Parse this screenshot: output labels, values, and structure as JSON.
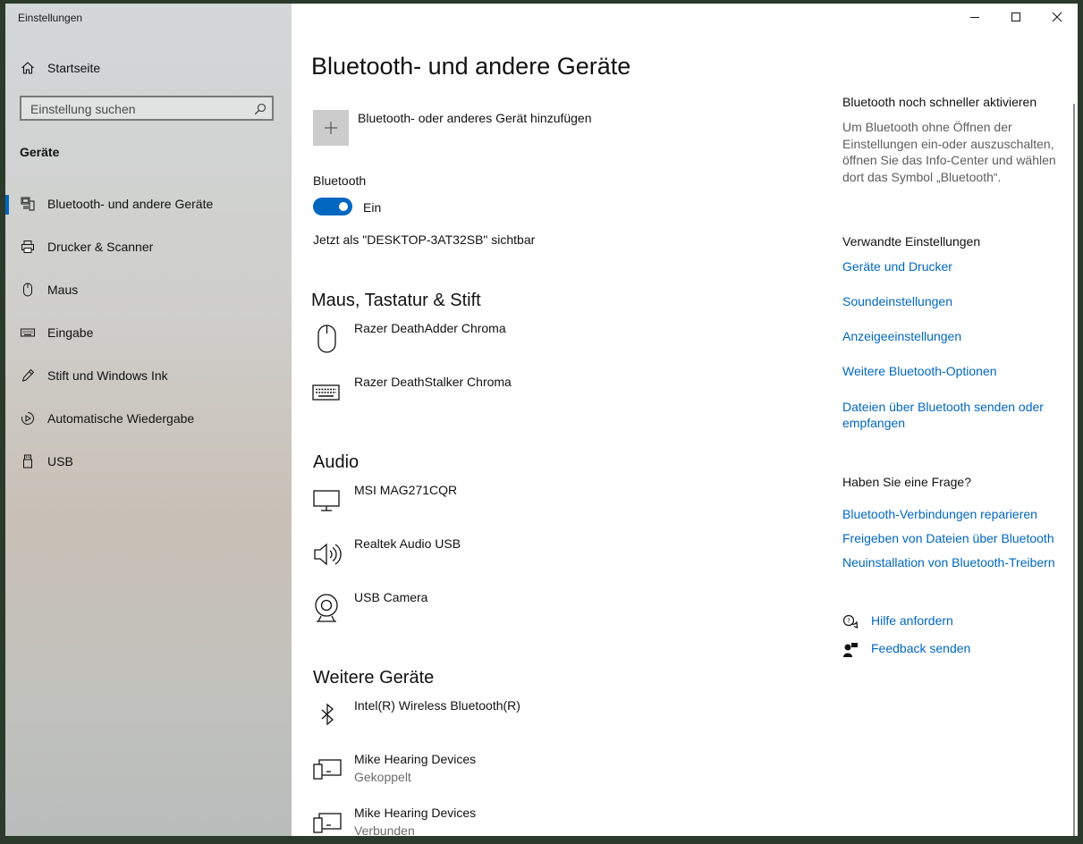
{
  "window": {
    "title": "Einstellungen"
  },
  "sidebar": {
    "home_label": "Startseite",
    "search_placeholder": "Einstellung suchen",
    "section_label": "Geräte",
    "items": [
      {
        "label": "Bluetooth- und andere Geräte",
        "icon": "bluetooth-devices-icon",
        "active": true
      },
      {
        "label": "Drucker & Scanner",
        "icon": "printer-icon"
      },
      {
        "label": "Maus",
        "icon": "mouse-icon"
      },
      {
        "label": "Eingabe",
        "icon": "keyboard-icon"
      },
      {
        "label": "Stift und Windows Ink",
        "icon": "pen-icon"
      },
      {
        "label": "Automatische Wiedergabe",
        "icon": "autoplay-icon"
      },
      {
        "label": "USB",
        "icon": "usb-icon"
      }
    ]
  },
  "main": {
    "title": "Bluetooth- und andere Geräte",
    "add_device_label": "Bluetooth- oder anderes Gerät hinzufügen",
    "bluetooth_label": "Bluetooth",
    "bluetooth_state": "Ein",
    "visible_as": "Jetzt als \"DESKTOP-3AT32SB\" sichtbar",
    "sections": [
      {
        "title": "Maus, Tastatur & Stift",
        "devices": [
          {
            "name": "Razer DeathAdder Chroma",
            "icon": "mouse-icon"
          },
          {
            "name": "Razer DeathStalker Chroma",
            "icon": "keyboard-icon"
          }
        ]
      },
      {
        "title": "Audio",
        "devices": [
          {
            "name": "MSI MAG271CQR",
            "icon": "monitor-icon"
          },
          {
            "name": "Realtek Audio USB",
            "icon": "speaker-icon"
          },
          {
            "name": "USB Camera",
            "icon": "webcam-icon"
          }
        ]
      },
      {
        "title": "Weitere Geräte",
        "devices": [
          {
            "name": "Intel(R) Wireless Bluetooth(R)",
            "icon": "bluetooth-icon"
          },
          {
            "name": "Mike Hearing Devices",
            "status": "Gekoppelt",
            "icon": "devices-icon"
          },
          {
            "name": "Mike Hearing Devices",
            "status": "Verbunden",
            "icon": "devices-icon"
          }
        ]
      }
    ]
  },
  "right": {
    "quick_title": "Bluetooth noch schneller aktivieren",
    "quick_text": "Um Bluetooth ohne Öffnen der Einstellungen ein-oder auszuschalten, öffnen Sie das Info-Center und wählen dort das Symbol „Bluetooth“.",
    "related_title": "Verwandte Einstellungen",
    "related_links": [
      "Geräte und Drucker",
      "Soundeinstellungen",
      "Anzeigeeinstellungen",
      "Weitere Bluetooth-Optionen",
      "Dateien über Bluetooth senden oder empfangen"
    ],
    "question_title": "Haben Sie eine Frage?",
    "question_links": [
      "Bluetooth-Verbindungen reparieren",
      "Freigeben von Dateien über Bluetooth",
      "Neuinstallation von Bluetooth-Treibern"
    ],
    "help_label": "Hilfe anfordern",
    "feedback_label": "Feedback senden"
  },
  "colors": {
    "accent": "#0067c0",
    "link": "#0067c0"
  }
}
